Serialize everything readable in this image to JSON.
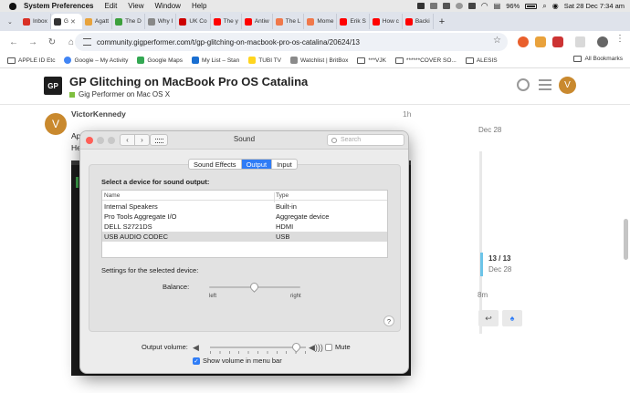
{
  "menubar": {
    "app": "System Preferences",
    "items": [
      "Edit",
      "View",
      "Window",
      "Help"
    ],
    "battery": "96%",
    "datetime": "Sat 28 Dec  7:34 am"
  },
  "tabs": [
    {
      "label": "Inbox",
      "color": "#d93025"
    },
    {
      "label": "G",
      "color": "#333333",
      "active": true
    },
    {
      "label": "Agatt",
      "color": "#e8a33c"
    },
    {
      "label": "The D",
      "color": "#3ca03c"
    },
    {
      "label": "Why I",
      "color": "#888888"
    },
    {
      "label": "UK Co",
      "color": "#cc0000"
    },
    {
      "label": "The y",
      "color": "#ff0000"
    },
    {
      "label": "Antiw",
      "color": "#ff0000"
    },
    {
      "label": "The L",
      "color": "#f0784a"
    },
    {
      "label": "Mome",
      "color": "#f0784a"
    },
    {
      "label": "Erik S",
      "color": "#ff0000"
    },
    {
      "label": "How c",
      "color": "#ff0000"
    },
    {
      "label": "Backi",
      "color": "#ff0000"
    }
  ],
  "address": {
    "url": "community.gigperformer.com/t/gp-glitching-on-macbook-pro-os-catalina/20624/13"
  },
  "bookmarks": [
    {
      "label": "APPLE ID Etc",
      "kind": "folder"
    },
    {
      "label": "Google – My Activity",
      "kind": "google"
    },
    {
      "label": "Google Maps",
      "kind": "maps"
    },
    {
      "label": "My List – Stan",
      "kind": "stan"
    },
    {
      "label": "TUBI TV",
      "kind": "tubi"
    },
    {
      "label": "Watchlist | BritBox",
      "kind": "britbox"
    },
    {
      "label": "***VJK",
      "kind": "folder"
    },
    {
      "label": "******COVER SO...",
      "kind": "folder"
    },
    {
      "label": "ALESIS",
      "kind": "folder"
    }
  ],
  "all_bookmarks": "All Bookmarks",
  "topic": {
    "title": "GP Glitching on MacBook Pro OS Catalina",
    "category": "Gig Performer on Mac OS X",
    "avatar_letter": "V"
  },
  "post": {
    "author": "VictorKennedy",
    "time": "1h",
    "line1": "Ap",
    "line2": "He"
  },
  "timeline": {
    "top_date": "Dec 28",
    "position": "13 / 13",
    "date": "Dec 28",
    "ago": "8m"
  },
  "sound": {
    "window_title": "Sound",
    "search_placeholder": "Search",
    "tabs": [
      "Sound Effects",
      "Output",
      "Input"
    ],
    "active_tab": "Output",
    "select_header": "Select a device for sound output:",
    "columns": [
      "Name",
      "Type"
    ],
    "devices": [
      {
        "name": "Internal Speakers",
        "type": "Built-in",
        "selected": false
      },
      {
        "name": "Pro Tools Aggregate I/O",
        "type": "Aggregate device",
        "selected": false
      },
      {
        "name": "DELL S2721DS",
        "type": "HDMI",
        "selected": false
      },
      {
        "name": "USB AUDIO  CODEC",
        "type": "USB",
        "selected": true
      }
    ],
    "settings_label": "Settings for the selected device:",
    "balance_label": "Balance:",
    "balance_left": "left",
    "balance_right": "right",
    "balance_value": 0.5,
    "help": "?",
    "output_volume_label": "Output volume:",
    "volume_value": 0.9,
    "mute_label": "Mute",
    "mute_checked": false,
    "show_volume_label": "Show volume in menu bar",
    "show_volume_checked": true
  }
}
